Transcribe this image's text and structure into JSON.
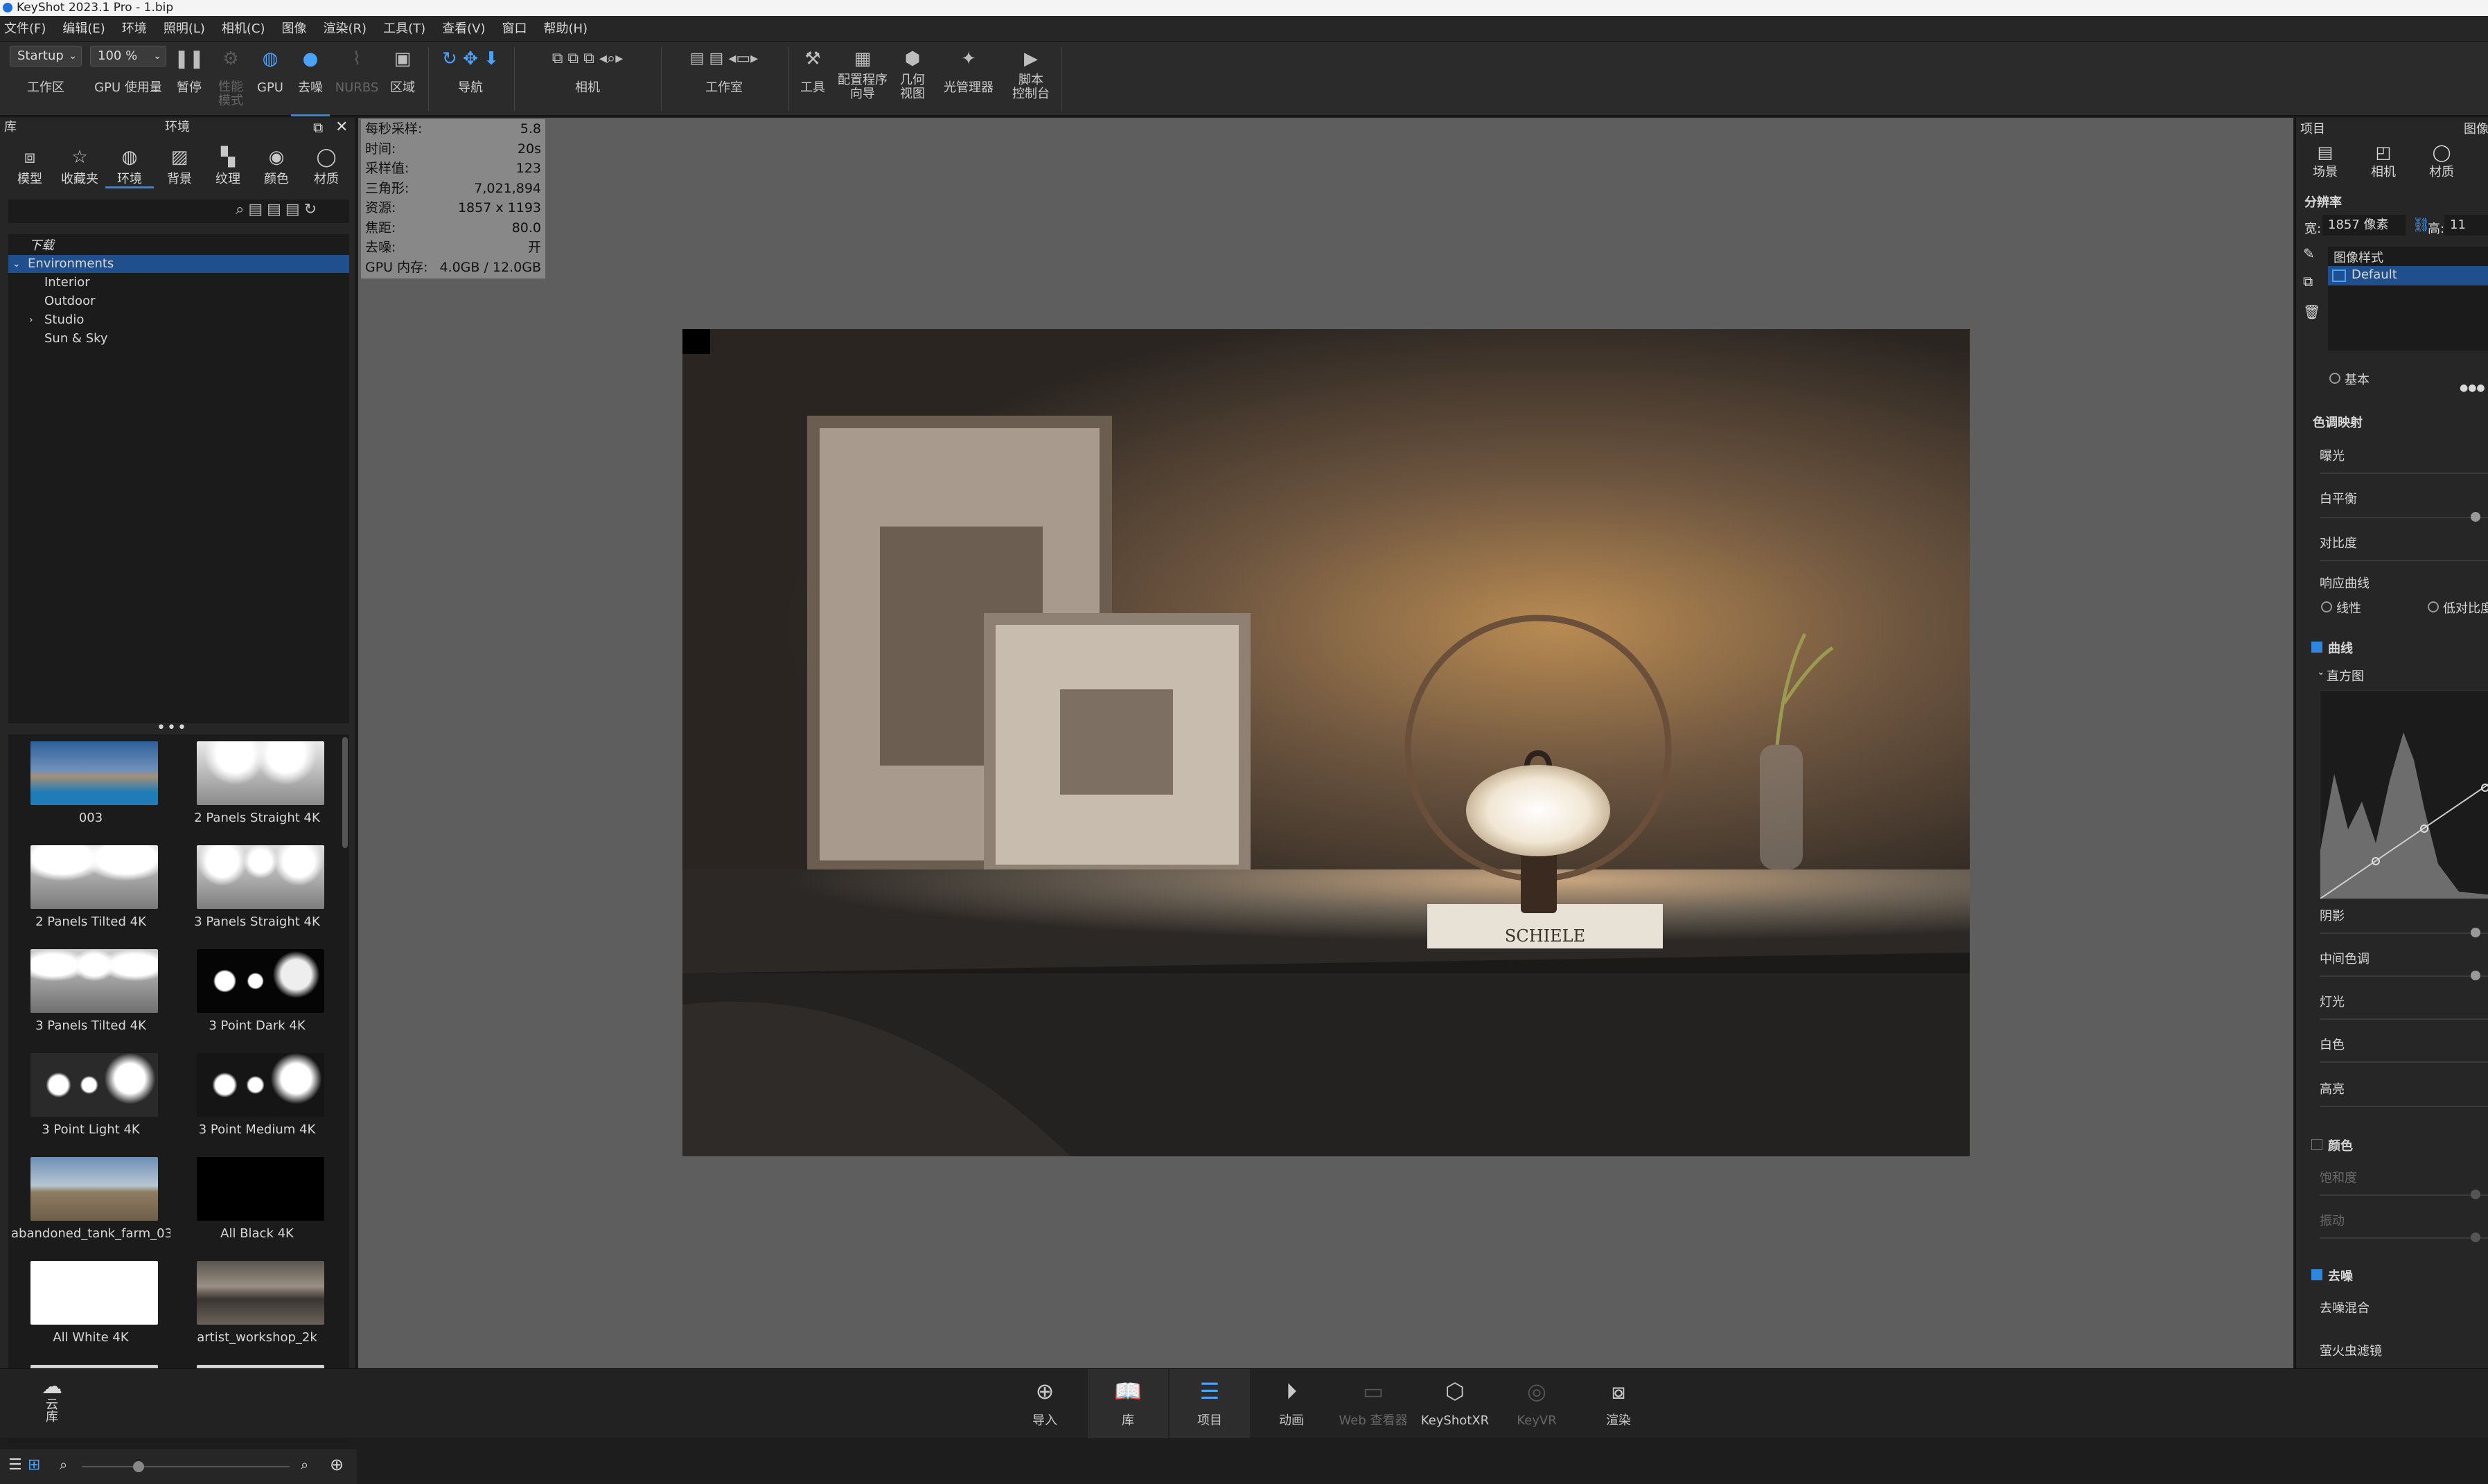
{
  "window": {
    "title": "KeyShot 2023.1 Pro - 1.bip"
  },
  "menu": [
    "文件(F)",
    "编辑(E)",
    "环境",
    "照明(L)",
    "相机(C)",
    "图像",
    "渲染(R)",
    "工具(T)",
    "查看(V)",
    "窗口",
    "帮助(H)"
  ],
  "ribbon": {
    "workspace_select": "Startup",
    "workspace_label": "工作区",
    "zoom_select": "100 %",
    "gpu_usage": "GPU 使用量",
    "pause": "暂停",
    "perf_mode": "性能\n模式",
    "gpu": "GPU",
    "denoise": "去噪",
    "nurbs": "NURBS",
    "region": "区域",
    "nav": "导航",
    "camera": "相机",
    "studio": "工作室",
    "tools": "工具",
    "wizard": "配置程序\n向导",
    "geometry": "几何\n视图",
    "lightmgr": "光管理器",
    "script": "脚本\n控制台"
  },
  "library": {
    "title": "库",
    "subtitle": "环境",
    "tabs": [
      "模型",
      "收藏夹",
      "环境",
      "背景",
      "纹理",
      "颜色",
      "材质"
    ],
    "active_tab": 2,
    "tree": [
      {
        "label": "下载",
        "level": 0,
        "style": "italic"
      },
      {
        "label": "Environments",
        "level": 0,
        "selected": true,
        "expanded": true
      },
      {
        "label": "Interior",
        "level": 1
      },
      {
        "label": "Outdoor",
        "level": 1
      },
      {
        "label": "Studio",
        "level": 1,
        "collapsed": true
      },
      {
        "label": "Sun & Sky",
        "level": 1
      }
    ],
    "thumbnails": [
      "003",
      "2 Panels Straight 4K",
      "2 Panels Tilted 4K",
      "3 Panels Straight 4K",
      "3 Panels Tilted 4K",
      "3 Point Dark 4K",
      "3 Point Light 4K",
      "3 Point Medium 4K",
      "abandoned_tank_farm_03...",
      "All Black 4K",
      "All White 4K",
      "artist_workshop_2k",
      "",
      ""
    ],
    "cloud": "云\n库"
  },
  "hud": [
    {
      "k": "每秒采样:",
      "v": "5.8"
    },
    {
      "k": "时间:",
      "v": "20s"
    },
    {
      "k": "采样值:",
      "v": "123"
    },
    {
      "k": "三角形:",
      "v": "7,021,894"
    },
    {
      "k": "资源:",
      "v": "1857 x 1193"
    },
    {
      "k": "焦距:",
      "v": "80.0"
    },
    {
      "k": "去噪:",
      "v": "开"
    },
    {
      "k": "GPU 内存:",
      "v": "4.0GB / 12.0GB"
    }
  ],
  "render_text": {
    "book": "SCHIELE"
  },
  "project": {
    "title": "项目",
    "image_tab": "图像",
    "tabs": [
      "场景",
      "相机",
      "材质"
    ],
    "resolution": "分辨率",
    "width_label": "宽:",
    "width_value": "1857 像素",
    "height_label": "高:",
    "height_value": "11",
    "image_styles": "图像样式",
    "style_default": "Default",
    "basic": "基本",
    "tonemap": "色调映射",
    "exposure": "曝光",
    "white_balance": "白平衡",
    "contrast": "对比度",
    "response_curve": "响应曲线",
    "linear": "线性",
    "low_contrast": "低对比度",
    "curve": "曲线",
    "histogram": "直方图",
    "shadows": "阴影",
    "midtones": "中间色调",
    "lights": "灯光",
    "whites": "白色",
    "highlights": "高亮",
    "color": "颜色",
    "saturation": "饱和度",
    "vibrance": "振动",
    "denoise": "去噪",
    "denoise_mix": "去噪混合",
    "firefly": "萤火虫滤镜"
  },
  "bottombar": [
    "导入",
    "库",
    "项目",
    "动画",
    "Web 查看器",
    "KeyShotXR",
    "KeyVR",
    "渲染"
  ],
  "colors": {
    "accent": "#2e86de",
    "selection": "#1f4f8c"
  }
}
